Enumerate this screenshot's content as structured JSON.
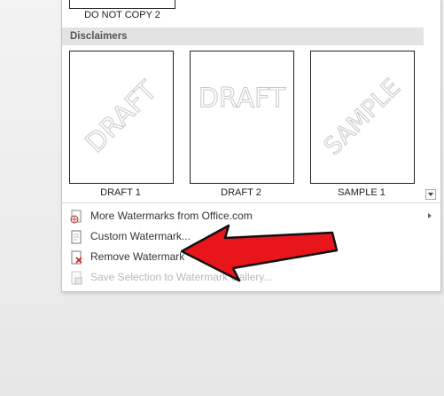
{
  "gallery": {
    "top_item_label": "DO NOT COPY 2",
    "section_title": "Disclaimers",
    "items": [
      {
        "label": "DRAFT 1",
        "watermark": "DRAFT",
        "style": "diagonal"
      },
      {
        "label": "DRAFT 2",
        "watermark": "DRAFT",
        "style": "horizontal"
      },
      {
        "label": "SAMPLE 1",
        "watermark": "SAMPLE",
        "style": "diagonal"
      }
    ]
  },
  "menu": {
    "more_watermarks": "More Watermarks from Office.com",
    "custom_watermark": "Custom Watermark...",
    "remove_watermark": "Remove Watermark",
    "save_selection": "Save Selection to Watermark Gallery..."
  },
  "colors": {
    "annotation_arrow": "#e8151b",
    "remove_icon_x": "#d9262b"
  }
}
